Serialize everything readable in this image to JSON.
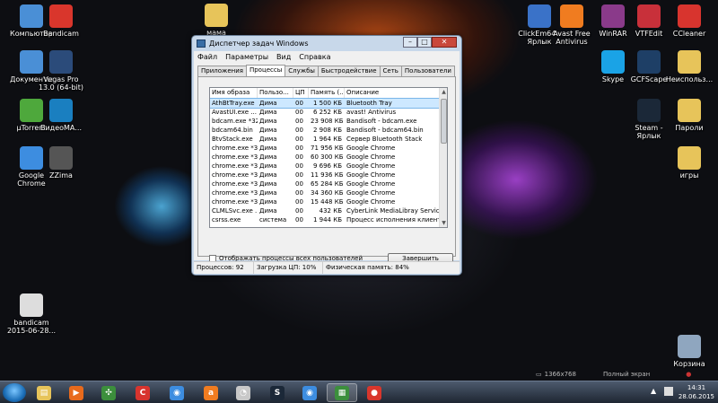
{
  "desktop": {
    "icons_left": [
      {
        "label": "Компьютер",
        "icon": "computer-icon",
        "color": "#4a8fd6"
      },
      {
        "label": "Bandicam",
        "icon": "bandicam-icon",
        "color": "#d9362c"
      },
      {
        "label": "Документы",
        "icon": "documents-icon",
        "color": "#4a8fd6"
      },
      {
        "label": "Vegas Pro\n13.0 (64-bit)",
        "icon": "vegas-icon",
        "color": "#2b4b7a"
      },
      {
        "label": "µTorrent",
        "icon": "utorrent-icon",
        "color": "#4ea83c"
      },
      {
        "label": "ВидеоМА...",
        "icon": "video-icon",
        "color": "#1a7fc0"
      },
      {
        "label": "Google\nChrome",
        "icon": "chrome-icon",
        "color": "#3d8de0"
      },
      {
        "label": "ZZima",
        "icon": "zzima-icon",
        "color": "#555555"
      },
      {
        "label": "мама",
        "icon": "folder-icon",
        "color": "#e7c45a"
      },
      {
        "label": "bandicam\n2015-06-28...",
        "icon": "video-file-icon",
        "color": "#dddddd"
      }
    ],
    "icons_right": [
      {
        "label": "ClickEm64 -\nЯрлык",
        "icon": "clickem-icon",
        "color": "#3a72c8"
      },
      {
        "label": "Avast Free\nAntivirus",
        "icon": "avast-icon",
        "color": "#f07c20"
      },
      {
        "label": "WinRAR",
        "icon": "winrar-icon",
        "color": "#8a3a8a"
      },
      {
        "label": "VTFEdit",
        "icon": "vtfedit-icon",
        "color": "#c8303a"
      },
      {
        "label": "CCleaner",
        "icon": "ccleaner-icon",
        "color": "#d8342e"
      },
      {
        "label": "Skype",
        "icon": "skype-icon",
        "color": "#1aa3e6"
      },
      {
        "label": "GCFScape",
        "icon": "gcfscape-icon",
        "color": "#1e3f66"
      },
      {
        "label": "Неиспольз...",
        "icon": "folder-icon",
        "color": "#e7c45a"
      },
      {
        "label": "Steam -\nЯрлык",
        "icon": "steam-icon",
        "color": "#1b2838"
      },
      {
        "label": "Пароли",
        "icon": "folder-icon",
        "color": "#e7c45a"
      },
      {
        "label": "игры",
        "icon": "folder-icon",
        "color": "#e7c45a"
      },
      {
        "label": "Корзина",
        "icon": "recycle-bin-icon",
        "color": "#8fa6bf"
      }
    ]
  },
  "window": {
    "title": "Диспетчер задач Windows",
    "controls": {
      "minimize": "–",
      "maximize": "□",
      "close": "✕"
    },
    "menu": [
      "Файл",
      "Параметры",
      "Вид",
      "Справка"
    ],
    "tabs": [
      "Приложения",
      "Процессы",
      "Службы",
      "Быстродействие",
      "Сеть",
      "Пользователи"
    ],
    "active_tab": "Процессы",
    "columns": [
      "Имя образа",
      "Пользо...",
      "ЦП",
      "Память (...",
      "Описание"
    ],
    "rows": [
      [
        "AthBtTray.exe",
        "Дима",
        "00",
        "1 500 КБ",
        "Bluetooth Tray"
      ],
      [
        "AvastUI.exe ...",
        "Дима",
        "00",
        "6 252 КБ",
        "avast! Antivirus"
      ],
      [
        "bdcam.exe *32",
        "Дима",
        "00",
        "23 908 КБ",
        "Bandisoft - bdcam.exe"
      ],
      [
        "bdcam64.bin",
        "Дима",
        "00",
        "2 908 КБ",
        "Bandisoft - bdcam64.bin"
      ],
      [
        "BtvStack.exe",
        "Дима",
        "00",
        "1 964 КБ",
        "Сервер Bluetooth Stack"
      ],
      [
        "chrome.exe *32",
        "Дима",
        "00",
        "71 956 КБ",
        "Google Chrome"
      ],
      [
        "chrome.exe *32",
        "Дима",
        "00",
        "60 300 КБ",
        "Google Chrome"
      ],
      [
        "chrome.exe *32",
        "Дима",
        "00",
        "9 696 КБ",
        "Google Chrome"
      ],
      [
        "chrome.exe *32",
        "Дима",
        "00",
        "11 936 КБ",
        "Google Chrome"
      ],
      [
        "chrome.exe *32",
        "Дима",
        "00",
        "65 284 КБ",
        "Google Chrome"
      ],
      [
        "chrome.exe *32",
        "Дима",
        "00",
        "34 360 КБ",
        "Google Chrome"
      ],
      [
        "chrome.exe *32",
        "Дима",
        "00",
        "15 448 КБ",
        "Google Chrome"
      ],
      [
        "CLMLSvc.exe ...",
        "Дима",
        "00",
        "432 КБ",
        "CyberLink MediaLibray Service"
      ],
      [
        "csrss.exe",
        "система",
        "00",
        "1 944 КБ",
        "Процесс исполнения клиент-серве"
      ]
    ],
    "show_all_users_label": "Отображать процессы всех пользователей",
    "end_process_label": "Завершить процесс",
    "status": {
      "processes": "Процессов: 92",
      "cpu": "Загрузка ЦП: 10%",
      "memory": "Физическая память: 84%"
    }
  },
  "recorder_bar": {
    "resolution": "1366x768",
    "mode": "Полный экран"
  },
  "taskbar": {
    "apps": [
      {
        "icon": "explorer-icon",
        "color": "#e7c45a",
        "glyph": "▤"
      },
      {
        "icon": "media-player-icon",
        "color": "#e86a1c",
        "glyph": "▶"
      },
      {
        "icon": "network-icon",
        "color": "#3c8f3c",
        "glyph": "✣"
      },
      {
        "icon": "ccleaner-icon",
        "color": "#d8342e",
        "glyph": "C"
      },
      {
        "icon": "chrome-icon",
        "color": "#3d8de0",
        "glyph": "◉"
      },
      {
        "icon": "avast-icon",
        "color": "#f07c20",
        "glyph": "a"
      },
      {
        "icon": "speedometer-icon",
        "color": "#c8c8c8",
        "glyph": "◔"
      },
      {
        "icon": "steam-icon",
        "color": "#1b2838",
        "glyph": "S"
      },
      {
        "icon": "chrome-icon",
        "color": "#3d8de0",
        "glyph": "◉"
      },
      {
        "icon": "task-manager-icon",
        "color": "#3c8f3c",
        "glyph": "▦"
      },
      {
        "icon": "bandicam-record-icon",
        "color": "#d9362c",
        "glyph": "●"
      }
    ],
    "clock_time": "14:31",
    "clock_date": "28.06.2015"
  }
}
